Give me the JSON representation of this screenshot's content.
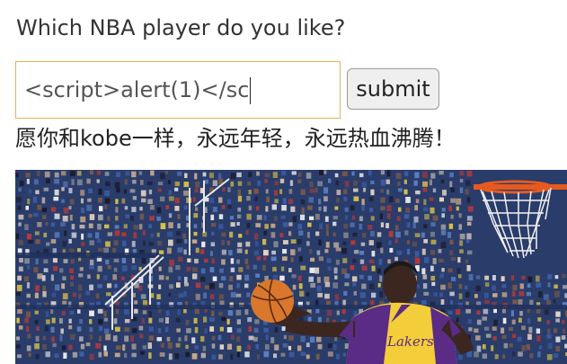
{
  "page": {
    "question": "Which NBA player do you like?",
    "input_value": "<script>alert(1)</sc",
    "submit_label": "submit",
    "result_message": "愿你和kobe一样，永远年轻，永远热血沸腾！"
  },
  "photo": {
    "jersey_text": "Lakers",
    "colors": {
      "jersey": "#f4ce3a",
      "trim": "#5a2c86",
      "ball": "#d9782d",
      "crowd": "#2a3c6a"
    }
  }
}
